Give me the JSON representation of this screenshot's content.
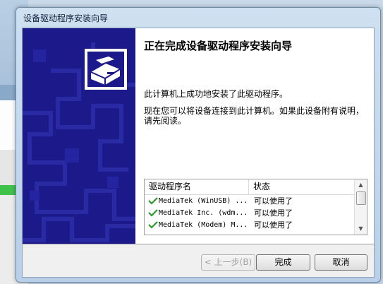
{
  "window": {
    "title": "设备驱动程序安装向导"
  },
  "wizard": {
    "heading": "正在完成设备驱动程序安装向导",
    "message1": "此计算机上成功地安装了此驱动程序。",
    "message2": "现在您可以将设备连接到此计算机。如果此设备附有说明，请先阅读。"
  },
  "driver_list": {
    "columns": [
      "驱动程序名",
      "状态"
    ],
    "rows": [
      {
        "name": "MediaTek (WinUSB) ...",
        "status": "可以使用了",
        "icon": "green-check-icon"
      },
      {
        "name": "MediaTek Inc. (wdm...",
        "status": "可以使用了",
        "icon": "green-check-icon"
      },
      {
        "name": "MediaTek (Modem) M...",
        "status": "可以使用了",
        "icon": "green-check-icon"
      }
    ]
  },
  "buttons": {
    "back": "< 上一步(B)",
    "finish": "完成",
    "cancel": "取消"
  },
  "colors": {
    "banner": "#1c1a8a",
    "check": "#2a9a2a",
    "background_progress": "#3fc24a"
  }
}
